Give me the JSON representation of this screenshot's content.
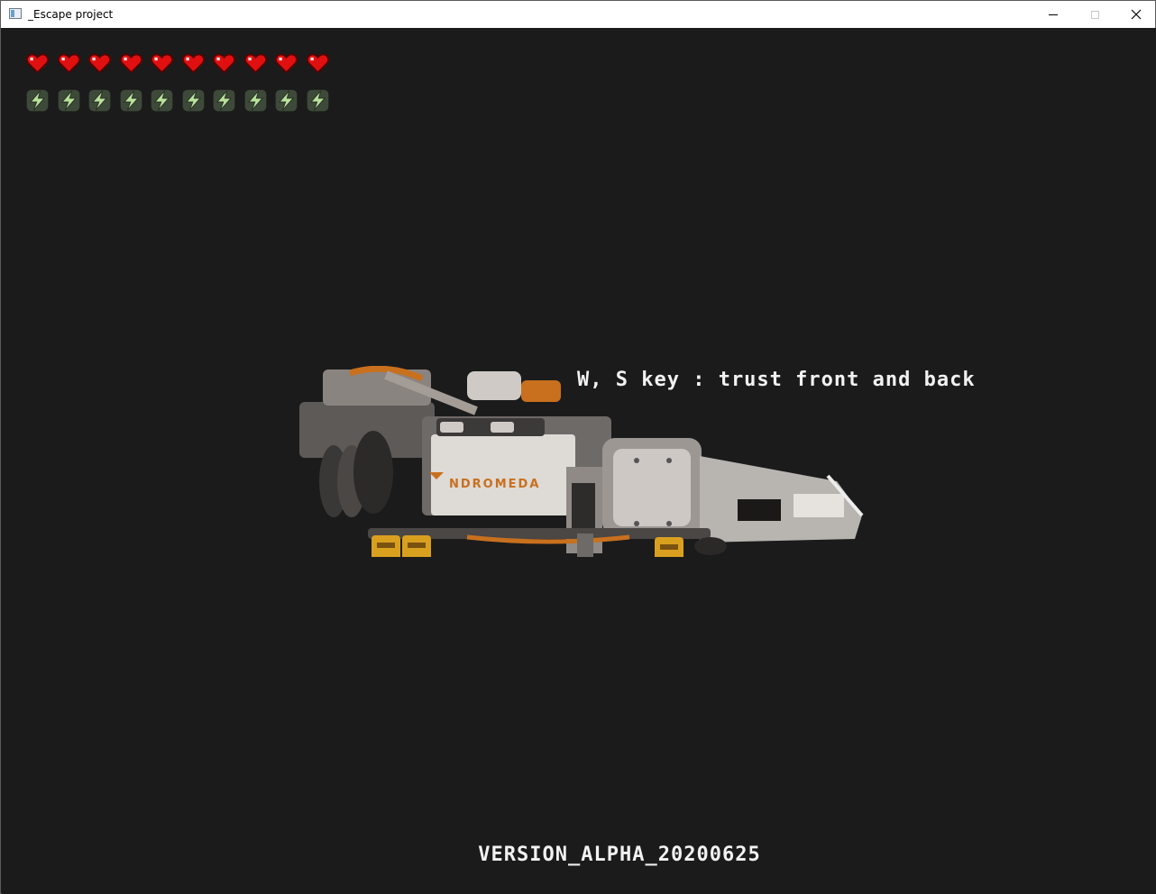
{
  "window": {
    "title": "_Escape project",
    "controls": {
      "minimize": "—",
      "maximize": "☐",
      "close": "✕"
    }
  },
  "hud": {
    "health": {
      "current": 10,
      "max": 10,
      "icon": "heart-icon",
      "color": "#e01010"
    },
    "energy": {
      "current": 10,
      "max": 10,
      "icon": "lightning-bolt-icon",
      "color": "#b9e39b"
    }
  },
  "hint_text": "W, S key : trust front and back",
  "ship": {
    "logo_text": "NDROMEDA",
    "name": "spaceship"
  },
  "version_text": "VERSION_ALPHA_20200625",
  "colors": {
    "background": "#1b1b1b",
    "text": "#f2f2f2",
    "ship_hull": "#b8b4b0",
    "ship_accent": "#c8701e",
    "thruster": "#d9a020"
  }
}
